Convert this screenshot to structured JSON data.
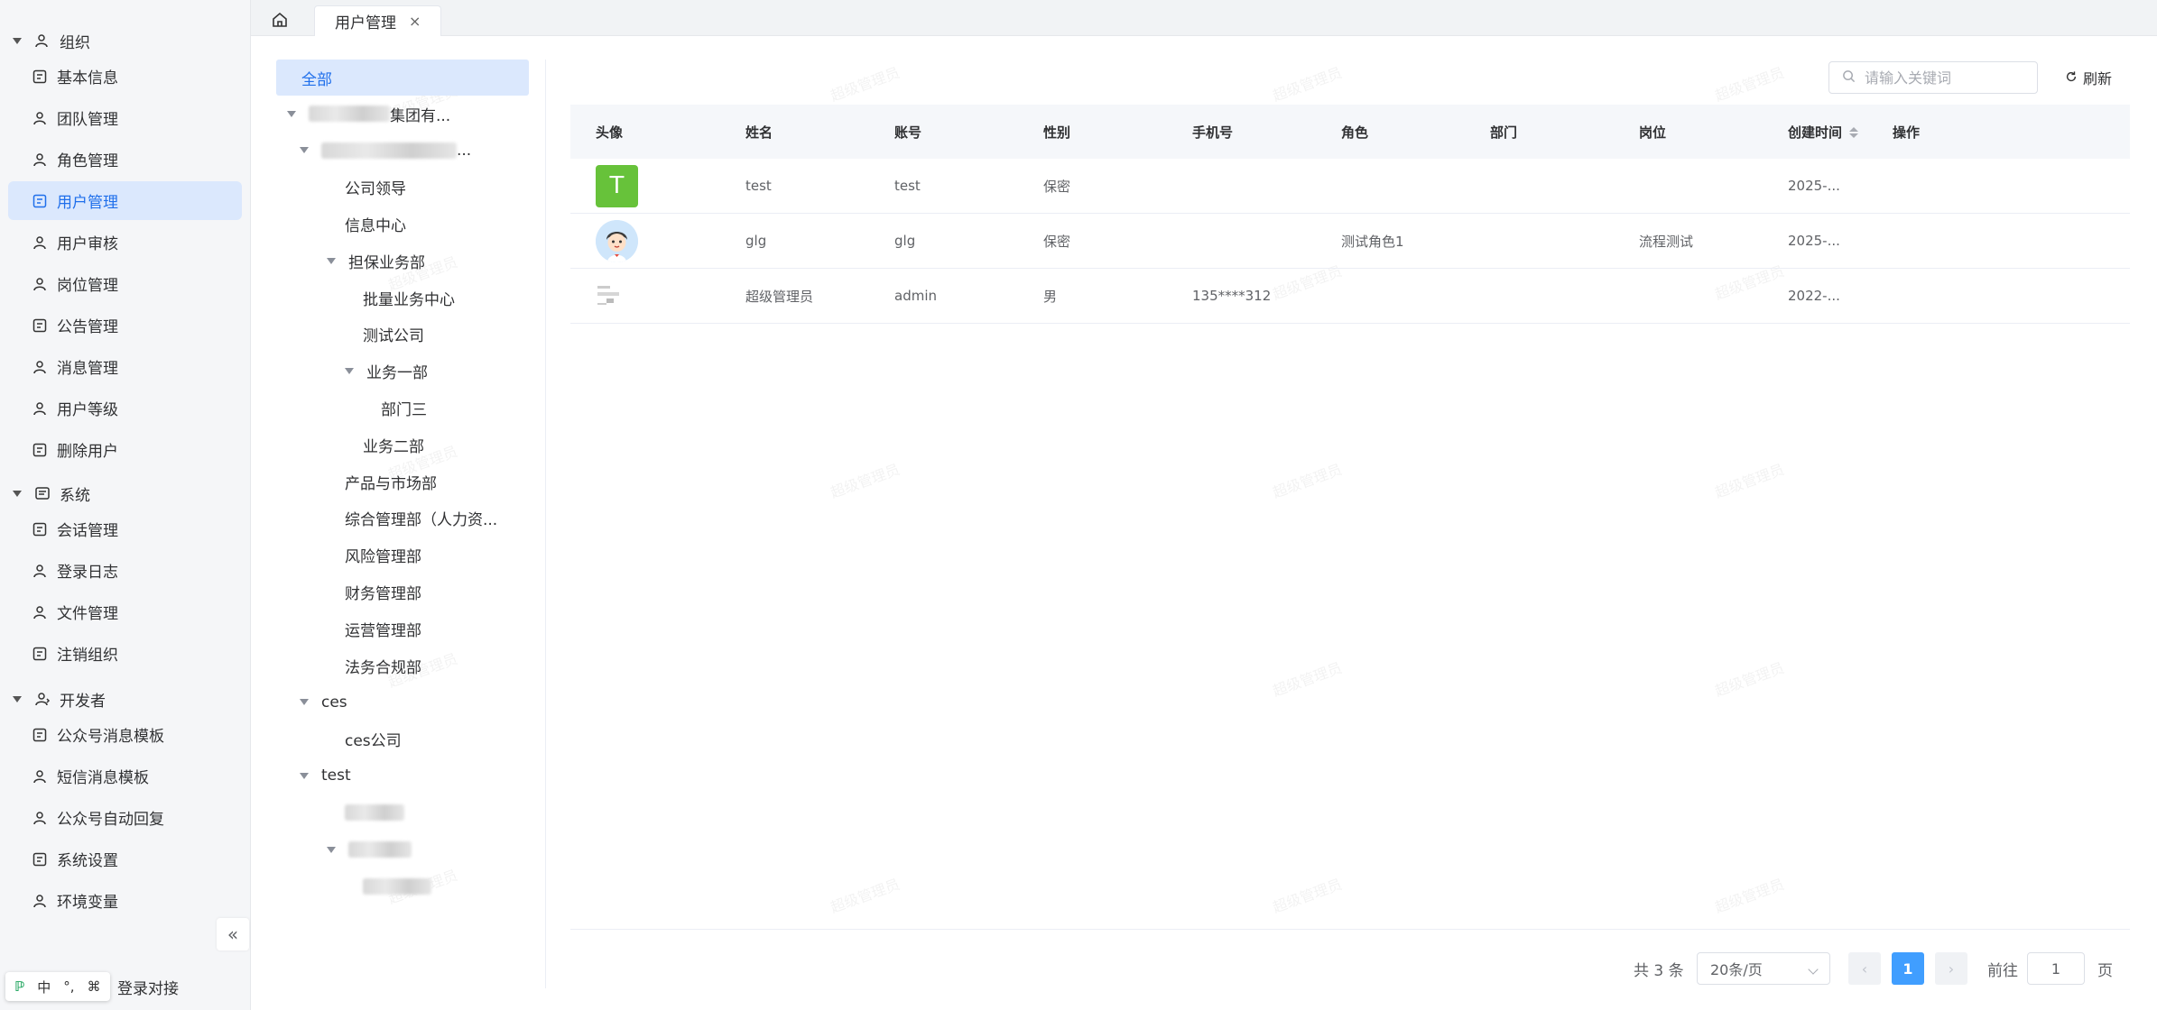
{
  "sidebar": {
    "groups": [
      {
        "label": "组织",
        "items": [
          {
            "label": "基本信息"
          },
          {
            "label": "团队管理"
          },
          {
            "label": "角色管理"
          },
          {
            "label": "用户管理",
            "active": true
          },
          {
            "label": "用户审核"
          },
          {
            "label": "岗位管理"
          },
          {
            "label": "公告管理"
          },
          {
            "label": "消息管理"
          },
          {
            "label": "用户等级"
          },
          {
            "label": "删除用户"
          }
        ]
      },
      {
        "label": "系统",
        "items": [
          {
            "label": "会话管理"
          },
          {
            "label": "登录日志"
          },
          {
            "label": "文件管理"
          },
          {
            "label": "注销组织"
          }
        ]
      },
      {
        "label": "开发者",
        "items": [
          {
            "label": "公众号消息模板"
          },
          {
            "label": "短信消息模板"
          },
          {
            "label": "公众号自动回复"
          },
          {
            "label": "系统设置"
          },
          {
            "label": "环境变量"
          }
        ]
      }
    ],
    "collapse_label": "«",
    "tail_item": "登录对接"
  },
  "ime": {
    "mode": "中",
    "punct": "°,",
    "extra": "⌘"
  },
  "tabs": {
    "active_tab": "用户管理",
    "close": "×"
  },
  "watermark": "超级管理员",
  "tree": {
    "all_label": "全部",
    "nodes": [
      {
        "label": "",
        "suffix": "集团有...",
        "indent": 0,
        "caret": true,
        "blur": 90
      },
      {
        "label": "",
        "suffix": "...",
        "indent": 1,
        "caret": true,
        "blur": 150
      },
      {
        "label": "公司领导",
        "indent": 2
      },
      {
        "label": "信息中心",
        "indent": 2
      },
      {
        "label": "担保业务部",
        "indent": 2,
        "caret": true
      },
      {
        "label": "批量业务中心",
        "indent": 3
      },
      {
        "label": "测试公司",
        "indent": 3
      },
      {
        "label": "业务一部",
        "indent": 3,
        "caret": true
      },
      {
        "label": "部门三",
        "indent": 4
      },
      {
        "label": "业务二部",
        "indent": 3
      },
      {
        "label": "产品与市场部",
        "indent": 2
      },
      {
        "label": "综合管理部（人力资...",
        "indent": 2
      },
      {
        "label": "风险管理部",
        "indent": 2
      },
      {
        "label": "财务管理部",
        "indent": 2
      },
      {
        "label": "运营管理部",
        "indent": 2
      },
      {
        "label": "法务合规部",
        "indent": 2
      },
      {
        "label": "ces",
        "indent": 1,
        "caret": true
      },
      {
        "label": "ces公司",
        "indent": 2
      },
      {
        "label": "test",
        "indent": 1,
        "caret": true
      },
      {
        "label": "",
        "indent": 2,
        "blur": 66
      },
      {
        "label": "",
        "indent": 2,
        "caret": true,
        "blur": 70
      },
      {
        "label": "",
        "indent": 3,
        "blur": 76
      }
    ]
  },
  "toolbar": {
    "search_placeholder": "请输入关键词",
    "refresh_label": "刷新"
  },
  "table": {
    "headers": [
      "头像",
      "姓名",
      "账号",
      "性别",
      "手机号",
      "角色",
      "部门",
      "岗位",
      "创建时间",
      "操作"
    ],
    "rows": [
      {
        "avatar": "T",
        "avatar_type": "letter",
        "avatar_color": "#67c23a",
        "name": "test",
        "account": "test",
        "gender": "保密",
        "phone": "",
        "role": "",
        "dept": "",
        "post": "",
        "created": "2025-...",
        "ops": ""
      },
      {
        "avatar": "",
        "avatar_type": "cartoon",
        "name": "glg",
        "account": "glg",
        "gender": "保密",
        "phone": "",
        "role": "测试角色1",
        "dept": "",
        "post": "流程测试",
        "created": "2025-...",
        "ops": ""
      },
      {
        "avatar": "",
        "avatar_type": "broken",
        "name": "超级管理员",
        "account": "admin",
        "gender": "男",
        "phone": "135****312",
        "role": "",
        "dept": "",
        "post": "",
        "created": "2022-...",
        "ops": ""
      }
    ]
  },
  "pagination": {
    "total_label": "共 3 条",
    "page_size": "20条/页",
    "prev": "‹",
    "current": "1",
    "next": "›",
    "goto_label": "前往",
    "goto_value": "1",
    "page_suffix": "页"
  },
  "colors": {
    "accent": "#1f6feb",
    "active_bg": "#dbe8fd",
    "pager_active": "#409eff"
  }
}
